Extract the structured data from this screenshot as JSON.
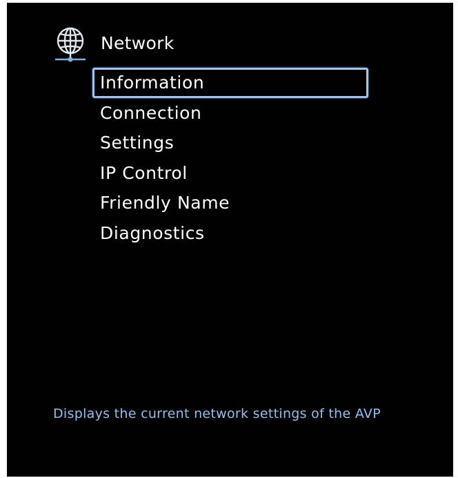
{
  "header": {
    "title": "Network",
    "icon": "globe-network-icon"
  },
  "menu": {
    "selected_index": 0,
    "items": [
      {
        "label": "Information"
      },
      {
        "label": "Connection"
      },
      {
        "label": "Settings"
      },
      {
        "label": "IP Control"
      },
      {
        "label": "Friendly Name"
      },
      {
        "label": "Diagnostics"
      }
    ]
  },
  "footer": {
    "hint": "Displays the current network settings of the AVP"
  },
  "colors": {
    "background": "#000000",
    "text": "#ffffff",
    "selection_border": "#9fc6f2",
    "hint_text": "#8fc0ee"
  }
}
